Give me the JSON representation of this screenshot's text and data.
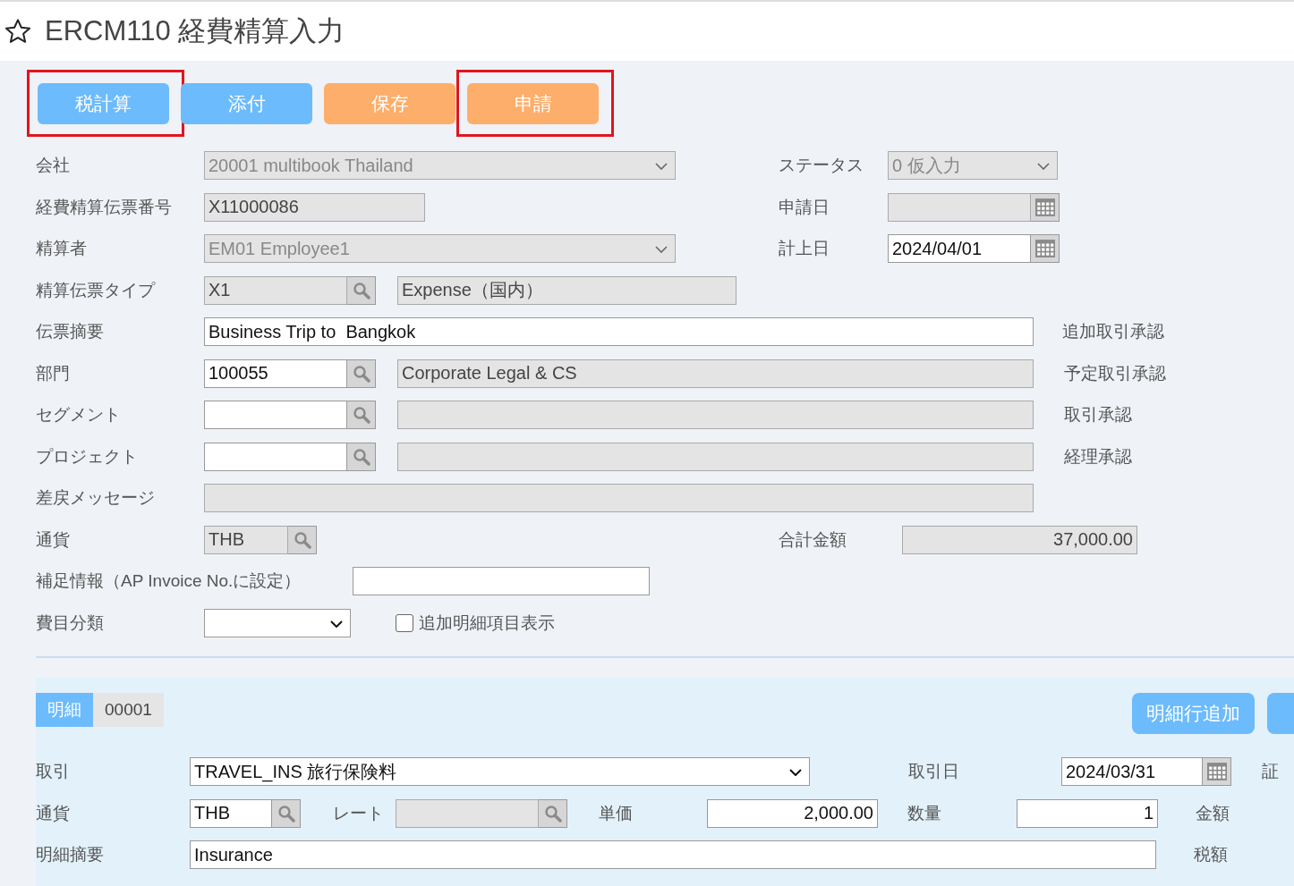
{
  "header": {
    "title": "ERCM110 経費精算入力"
  },
  "toolbar": [
    {
      "label": "税計算",
      "color": "#6cbbfc",
      "highlighted": true
    },
    {
      "label": "添付",
      "color": "#6cbbfc",
      "highlighted": false
    },
    {
      "label": "保存",
      "color": "#fdae6b",
      "highlighted": false
    },
    {
      "label": "申請",
      "color": "#fdae6b",
      "highlighted": true
    }
  ],
  "form": {
    "company": {
      "label": "会社",
      "value": "20001 multibook Thailand",
      "disabled": true
    },
    "status": {
      "label": "ステータス",
      "value": "0 仮入力",
      "disabled": true
    },
    "slip_no": {
      "label": "経費精算伝票番号",
      "value": "X11000086",
      "disabled": true
    },
    "apply_date": {
      "label": "申請日",
      "disabled": true
    },
    "employee": {
      "label": "精算者",
      "value": "EM01 Employee1",
      "disabled": true
    },
    "post_date": {
      "label": "計上日",
      "value": "2024/04/01",
      "disabled": false
    },
    "slip_type": {
      "label": "精算伝票タイプ",
      "code": "X1",
      "name": "Expense（国内）",
      "disabled": true
    },
    "summary": {
      "label": "伝票摘要",
      "value": "Business Trip to  Bangkok",
      "disabled": false
    },
    "approvals": [
      "追加取引承認",
      "予定取引承認",
      "取引承認",
      "経理承認"
    ],
    "lookups": [
      {
        "label": "部門",
        "code": "100055",
        "name": "Corporate Legal & CS",
        "disabled": false
      },
      {
        "label": "セグメント",
        "disabled": false
      },
      {
        "label": "プロジェクト",
        "disabled": false
      }
    ],
    "return_message": {
      "label": "差戻メッセージ",
      "disabled": true
    },
    "currency": {
      "label": "通貨",
      "value": "THB",
      "disabled": true
    },
    "total": {
      "label": "合計金額",
      "value": "37,000.00",
      "disabled": true
    },
    "extra_info": {
      "label": "補足情報（AP Invoice No.に設定）",
      "disabled": false
    },
    "expense_class": {
      "label": "費目分類",
      "disabled": false
    },
    "show_extra": {
      "label": "追加明細項目表示",
      "checked": false
    }
  },
  "detail": {
    "tabs": [
      {
        "label": "明細",
        "selected": true
      },
      {
        "label": "00001",
        "selected": false
      }
    ],
    "add_button": "明細行追加",
    "transaction": {
      "label": "取引",
      "value": "TRAVEL_INS 旅行保険料"
    },
    "transaction_date": {
      "label": "取引日",
      "value": "2024/03/31"
    },
    "voucher": {
      "label": "証"
    },
    "currency": {
      "label": "通貨",
      "value": "THB"
    },
    "rate": {
      "label": "レート",
      "disabled": true
    },
    "unit_price": {
      "label": "単価",
      "value": "2,000.00"
    },
    "quantity": {
      "label": "数量",
      "value": "1"
    },
    "amount": {
      "label": "金額"
    },
    "description": {
      "label": "明細摘要",
      "value": "Insurance"
    },
    "tax": {
      "label": "税額"
    }
  }
}
